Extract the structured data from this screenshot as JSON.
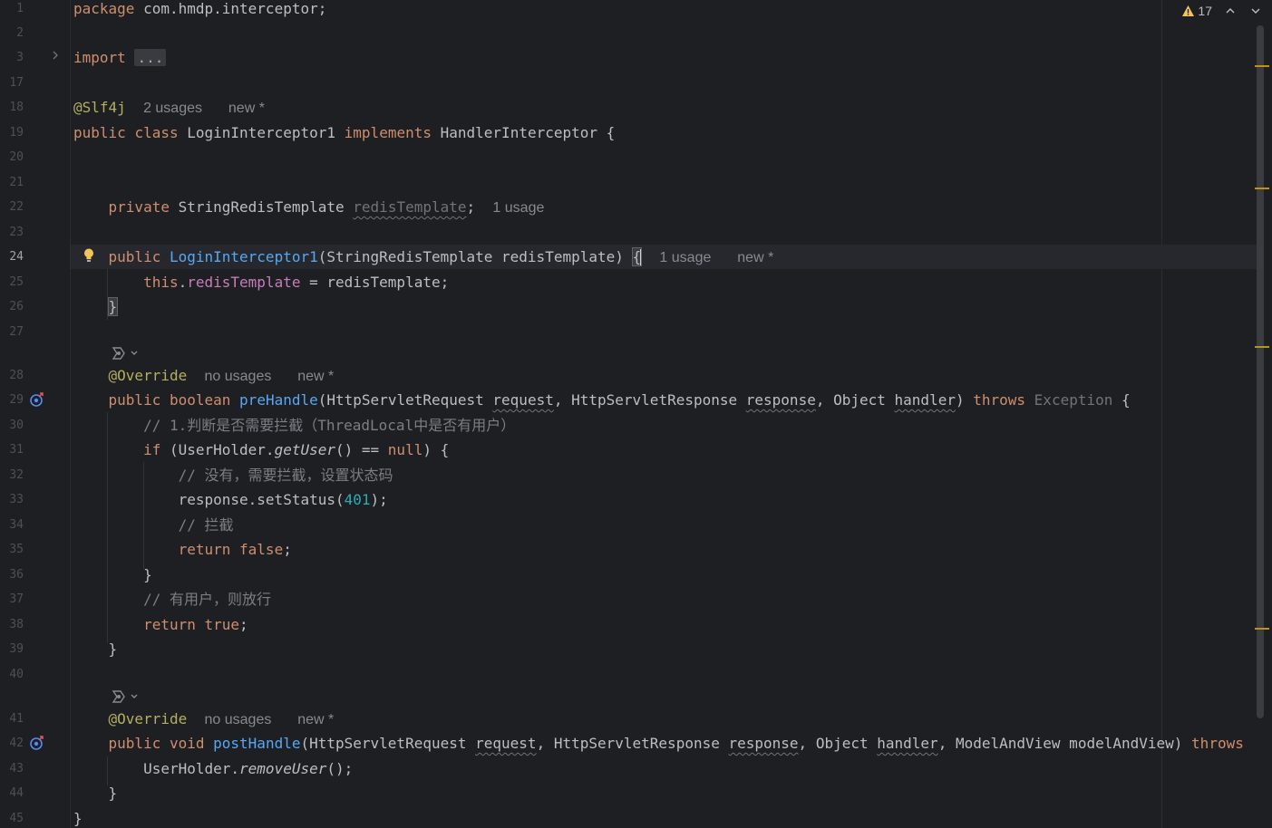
{
  "editor": {
    "problems": {
      "count": "17"
    },
    "line_numbers": [
      "1",
      "2",
      "3",
      "17",
      "18",
      "19",
      "20",
      "21",
      "22",
      "23",
      "24",
      "25",
      "26",
      "27",
      "28",
      "29",
      "30",
      "31",
      "32",
      "33",
      "34",
      "35",
      "36",
      "37",
      "38",
      "39",
      "40",
      "41",
      "42",
      "43",
      "44",
      "45"
    ],
    "current_line": "24",
    "lines": {
      "l1_kw": "package",
      "l1_rest": " com.hmdp.interceptor;",
      "l3_kw": "import",
      "l3_fold": "...",
      "l18_ann": "@Slf4j",
      "l18_hint1": "2 usages",
      "l18_hint2": "new *",
      "l19_kw1": "public",
      "l19_kw2": "class",
      "l19_name": "LoginInterceptor1",
      "l19_kw3": "implements",
      "l19_rest": "HandlerInterceptor {",
      "l22_kw": "private",
      "l22_type": "StringRedisTemplate",
      "l22_field": "redisTemplate",
      "l22_semi": ";",
      "l22_hint": "1 usage",
      "l24_kw": "public",
      "l24_fn": "LoginInterceptor1",
      "l24_rest": "(StringRedisTemplate redisTemplate) ",
      "l24_brace": "{",
      "l24_hint1": "1 usage",
      "l24_hint2": "new *",
      "l25_kw": "this",
      "l25_dot": ".",
      "l25_field": "redisTemplate",
      "l25_rest": " = redisTemplate;",
      "l26": "}",
      "l28_ann": "@Override",
      "l28_hint1": "no usages",
      "l28_hint2": "new *",
      "l29_kw1": "public",
      "l29_kw2": "boolean",
      "l29_fn": "preHandle",
      "l29_p1": "(HttpServletRequest ",
      "l29_request": "request",
      "l29_p2": ", HttpServletResponse ",
      "l29_response": "response",
      "l29_p3": ", Object ",
      "l29_handler": "handler",
      "l29_p4": ") ",
      "l29_throws": "throws",
      "l29_exc": "Exception",
      "l29_brace": " {",
      "l30": "// 1.判断是否需要拦截（ThreadLocal中是否有用户）",
      "l31_kw": "if",
      "l31_p1": " (UserHolder.",
      "l31_fn": "getUser",
      "l31_p2": "() == ",
      "l31_null": "null",
      "l31_p3": ") {",
      "l32": "// 没有，需要拦截，设置状态码",
      "l33_p1": "response.setStatus(",
      "l33_num": "401",
      "l33_p2": ");",
      "l34": "// 拦截",
      "l35_kw1": "return",
      "l35_kw2": "false",
      "l35_semi": ";",
      "l36": "}",
      "l37": "// 有用户，则放行",
      "l38_kw1": "return",
      "l38_kw2": "true",
      "l38_semi": ";",
      "l39": "}",
      "l41_ann": "@Override",
      "l41_hint1": "no usages",
      "l41_hint2": "new *",
      "l42_kw1": "public",
      "l42_kw2": "void",
      "l42_fn": "postHandle",
      "l42_p1": "(HttpServletRequest ",
      "l42_request": "request",
      "l42_p2": ", HttpServletResponse ",
      "l42_response": "response",
      "l42_p3": ", Object ",
      "l42_handler": "handler",
      "l42_p4": ", ModelAndView modelAndView) ",
      "l42_throws": "throws",
      "l43_p1": "UserHolder.",
      "l43_fn": "removeUser",
      "l43_p2": "();",
      "l44": "}",
      "l45": "}"
    }
  },
  "colors": {
    "background": "#1e1f22",
    "keyword": "#cf8e6d",
    "annotation": "#b3ae60",
    "function": "#56a8f5",
    "field": "#c77dbb",
    "number": "#2aacb8",
    "comment": "#7a7e85",
    "warning": "#be9117"
  },
  "icons": [
    "warning-icon",
    "chevron-up-icon",
    "chevron-down-icon",
    "fold-chevron-icon",
    "lightbulb-icon",
    "ai-lens-icon",
    "implements-gutter-icon"
  ]
}
